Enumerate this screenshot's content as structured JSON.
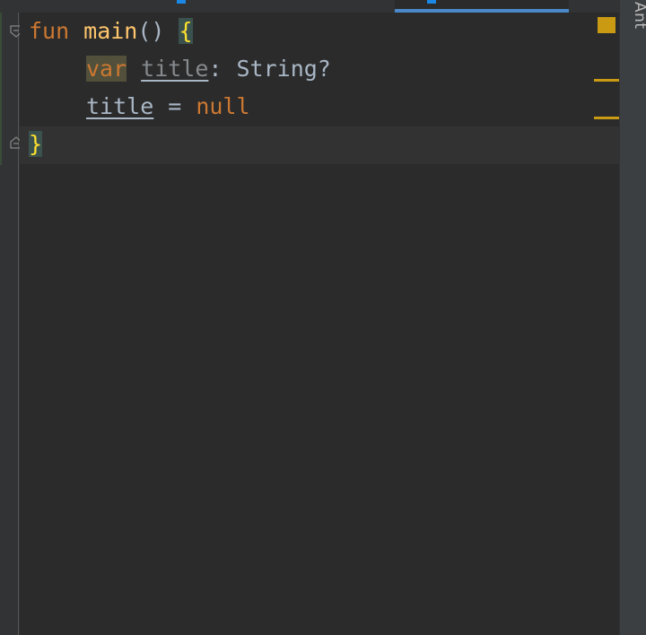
{
  "code": {
    "line1": {
      "kw_fun": "fun",
      "fn_name": "main",
      "parens": "()",
      "open_brace": "{"
    },
    "line2": {
      "kw_var": "var",
      "ident": "title",
      "colon": ":",
      "type": "String?"
    },
    "line3": {
      "ident": "title",
      "op": "=",
      "kw_null": "null"
    },
    "line4": {
      "close_brace": "}"
    }
  },
  "side_panel": {
    "label": "Ant"
  },
  "colors": {
    "background": "#2b2b2b",
    "keyword": "#cc7832",
    "function": "#ffc66d",
    "text": "#a9b7c6",
    "warning": "#c99a12",
    "accent": "#4a88c7"
  }
}
